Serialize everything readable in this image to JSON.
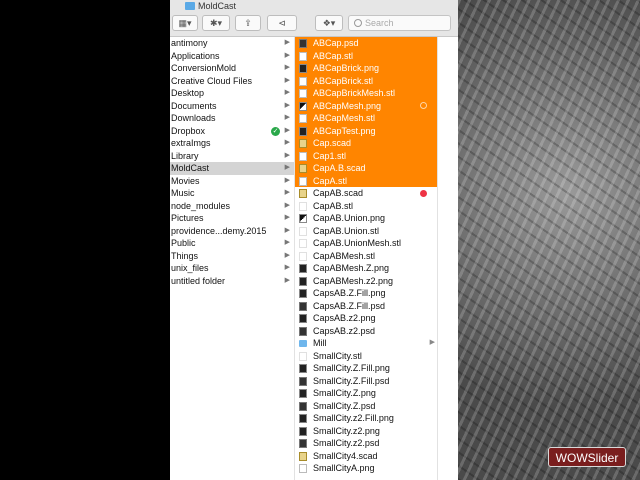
{
  "window": {
    "title": "MoldCast"
  },
  "toolbar": {
    "search_placeholder": "Search"
  },
  "column1": {
    "items": [
      {
        "label": "antimony",
        "arrow": "▶"
      },
      {
        "label": "Applications",
        "arrow": "▶"
      },
      {
        "label": "ConversionMold",
        "arrow": "▶"
      },
      {
        "label": "Creative Cloud Files",
        "arrow": "▶"
      },
      {
        "label": "Desktop",
        "arrow": "▶"
      },
      {
        "label": "Documents",
        "arrow": "▶"
      },
      {
        "label": "Downloads",
        "arrow": "▶"
      },
      {
        "label": "Dropbox",
        "arrow": "▶",
        "badge": "✓"
      },
      {
        "label": "extraImgs",
        "arrow": "▶"
      },
      {
        "label": "Library",
        "arrow": "▶"
      },
      {
        "label": "MoldCast",
        "arrow": "▶",
        "selected": true
      },
      {
        "label": "Movies",
        "arrow": "▶"
      },
      {
        "label": "Music",
        "arrow": "▶"
      },
      {
        "label": "node_modules",
        "arrow": "▶"
      },
      {
        "label": "Pictures",
        "arrow": "▶"
      },
      {
        "label": "providence...demy.2015",
        "arrow": "▶"
      },
      {
        "label": "Public",
        "arrow": "▶"
      },
      {
        "label": "Things",
        "arrow": "▶"
      },
      {
        "label": "unix_files",
        "arrow": "▶"
      },
      {
        "label": "untitled folder",
        "arrow": "▶"
      }
    ]
  },
  "column2": {
    "items": [
      {
        "label": "ABCap.psd",
        "icon": "psd",
        "selected": true
      },
      {
        "label": "ABCap.stl",
        "icon": "doc",
        "selected": true
      },
      {
        "label": "ABCapBrick.png",
        "icon": "dark",
        "selected": true
      },
      {
        "label": "ABCapBrick.stl",
        "icon": "doc",
        "selected": true
      },
      {
        "label": "ABCapBrickMesh.stl",
        "icon": "doc",
        "selected": true
      },
      {
        "label": "ABCapMesh.png",
        "icon": "mesh",
        "selected": true,
        "tag": "sync"
      },
      {
        "label": "ABCapMesh.stl",
        "icon": "doc",
        "selected": true
      },
      {
        "label": "ABCapTest.png",
        "icon": "dark",
        "selected": true
      },
      {
        "label": "Cap.scad",
        "icon": "scad",
        "selected": true
      },
      {
        "label": "Cap1.stl",
        "icon": "doc",
        "selected": true
      },
      {
        "label": "CapA.B.scad",
        "icon": "scad",
        "selected": true
      },
      {
        "label": "CapA.stl",
        "icon": "doc",
        "selected": true
      },
      {
        "label": "CapAB.scad",
        "icon": "scad",
        "tag": "red"
      },
      {
        "label": "CapAB.stl",
        "icon": "blank"
      },
      {
        "label": "CapAB.Union.png",
        "icon": "mesh"
      },
      {
        "label": "CapAB.Union.stl",
        "icon": "blank"
      },
      {
        "label": "CapAB.UnionMesh.stl",
        "icon": "blank"
      },
      {
        "label": "CapABMesh.stl",
        "icon": "blank"
      },
      {
        "label": "CapABMesh.Z.png",
        "icon": "dark"
      },
      {
        "label": "CapABMesh.z2.png",
        "icon": "dark"
      },
      {
        "label": "CapsAB.Z.Fill.png",
        "icon": "dark"
      },
      {
        "label": "CapsAB.Z.Fill.psd",
        "icon": "psd"
      },
      {
        "label": "CapsAB.z2.png",
        "icon": "dark"
      },
      {
        "label": "CapsAB.z2.psd",
        "icon": "psd"
      },
      {
        "label": "Mill",
        "icon": "folder",
        "arrow": "▶"
      },
      {
        "label": "SmallCity.stl",
        "icon": "blank"
      },
      {
        "label": "SmallCity.Z.Fill.png",
        "icon": "dark"
      },
      {
        "label": "SmallCity.Z.Fill.psd",
        "icon": "psd"
      },
      {
        "label": "SmallCity.Z.png",
        "icon": "dark"
      },
      {
        "label": "SmallCity.Z.psd",
        "icon": "psd"
      },
      {
        "label": "SmallCity.z2.Fill.png",
        "icon": "dark"
      },
      {
        "label": "SmallCity.z2.png",
        "icon": "dark"
      },
      {
        "label": "SmallCity.z2.psd",
        "icon": "psd"
      },
      {
        "label": "SmallCity4.scad",
        "icon": "scad"
      },
      {
        "label": "SmallCityA.png",
        "icon": "doc"
      }
    ]
  },
  "overlay": {
    "watermark": "WOWSlider"
  },
  "colors": {
    "selection": "#ff8500",
    "sidebar_selection": "#d4d4d4",
    "tag_red": "#ee3344",
    "dropbox_badge": "#2aa84a"
  }
}
